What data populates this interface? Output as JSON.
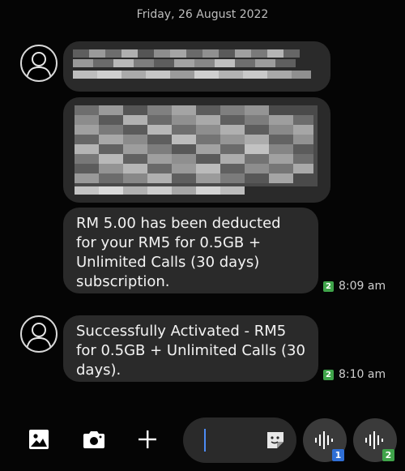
{
  "date_header": "Friday, 26 August 2022",
  "messages": [
    {
      "text": "",
      "redacted": true
    },
    {
      "text": "",
      "redacted": true
    },
    {
      "text": "RM 5.00 has been deducted\nfor your RM5 for 0.5GB +\nUnlimited Calls (30 days)\nsubscription.",
      "sim": "2",
      "time": "8:09 am"
    },
    {
      "text": "Successfully Activated - RM5\nfor 0.5GB + Unlimited Calls (30\ndays).",
      "sim": "2",
      "time": "8:10 am"
    }
  ],
  "composer": {
    "gallery_icon": "image-icon",
    "camera_icon": "camera-icon",
    "add_icon": "plus-icon",
    "sticker_icon": "sticker-icon",
    "input_value": "",
    "voice_sim1_label": "1",
    "voice_sim2_label": "2",
    "sim1_color": "#2f6fd6",
    "sim2_color": "#3fa44a"
  }
}
